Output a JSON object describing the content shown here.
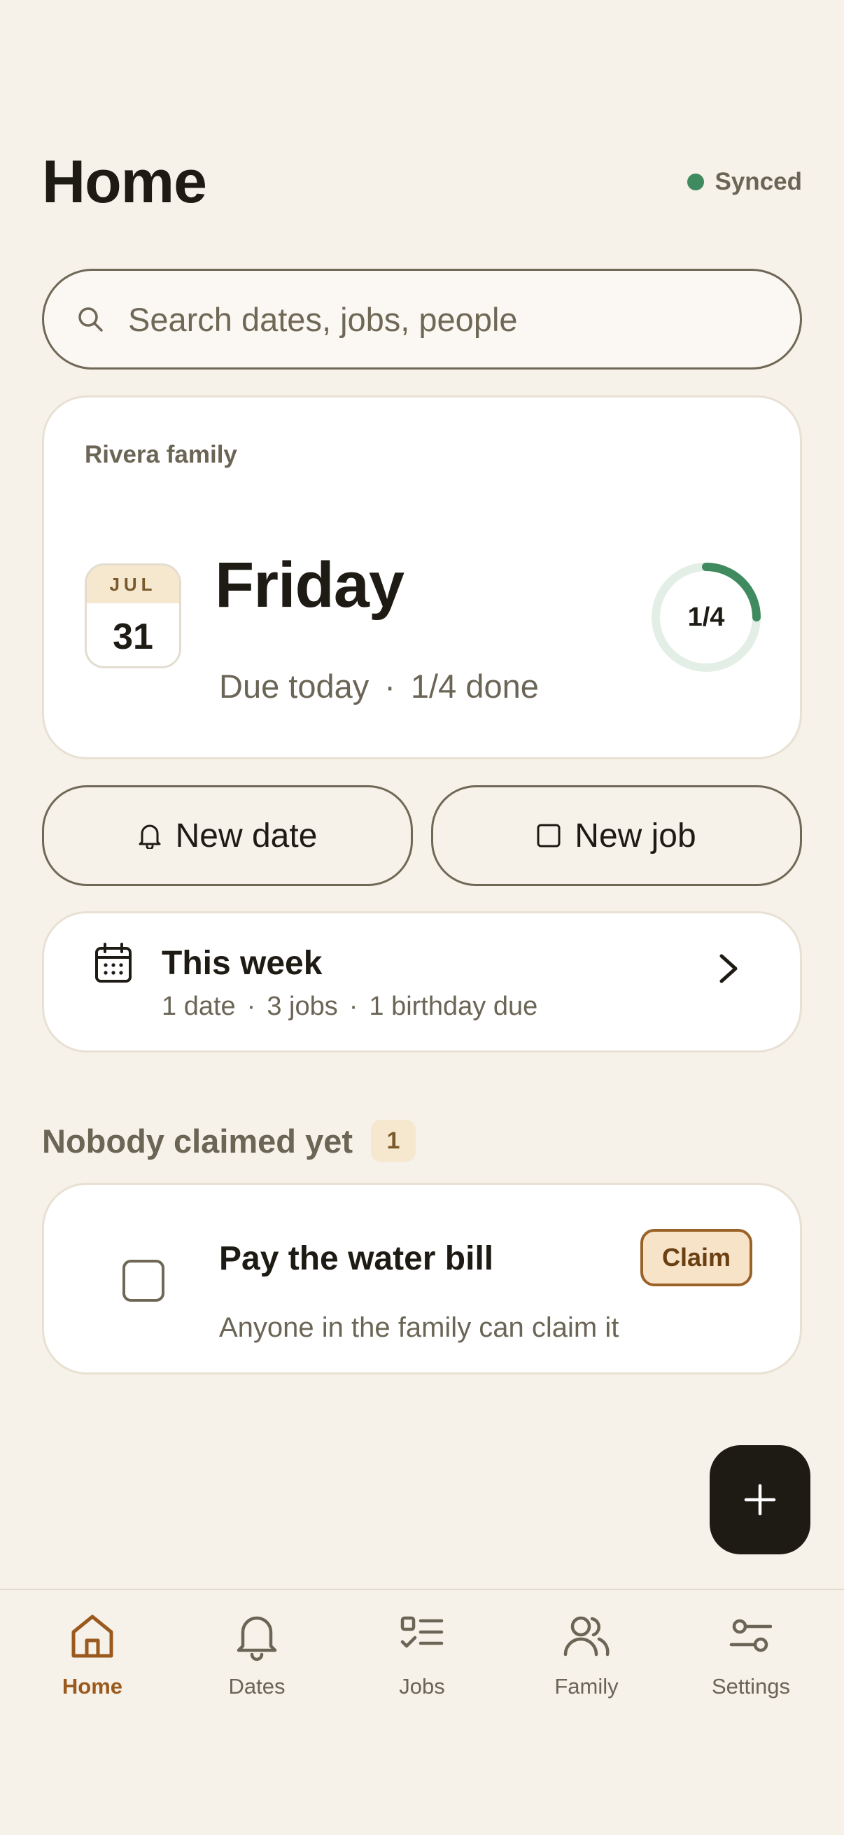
{
  "header": {
    "title": "Home",
    "sync_status": "Synced",
    "sync_color": "#3f8a5f"
  },
  "search": {
    "placeholder": "Search dates, jobs, people",
    "value": ""
  },
  "today_card": {
    "family_name": "Rivera family",
    "month": "JUL",
    "day": "31",
    "weekday": "Friday",
    "due_label": "Due today",
    "done_label": "1/4 done",
    "progress_label": "1/4",
    "progress_fraction": 0.25
  },
  "actions": {
    "new_date": "New date",
    "new_job": "New job"
  },
  "week": {
    "title": "This week",
    "dates": "1 date",
    "jobs": "3 jobs",
    "birthdays": "1 birthday due"
  },
  "unclaimed": {
    "title": "Nobody claimed yet",
    "count": "1",
    "tasks": [
      {
        "title": "Pay the water bill",
        "subtitle": "Anyone in the family can claim it",
        "action": "Claim"
      }
    ]
  },
  "nav": {
    "items": [
      {
        "label": "Home",
        "icon": "home-icon",
        "active": true
      },
      {
        "label": "Dates",
        "icon": "bell-icon",
        "active": false
      },
      {
        "label": "Jobs",
        "icon": "checklist-icon",
        "active": false
      },
      {
        "label": "Family",
        "icon": "people-icon",
        "active": false
      },
      {
        "label": "Settings",
        "icon": "sliders-icon",
        "active": false
      }
    ]
  },
  "colors": {
    "background": "#f6f1e9",
    "accent": "#9a5a1e",
    "progress": "#3f8a5f"
  }
}
